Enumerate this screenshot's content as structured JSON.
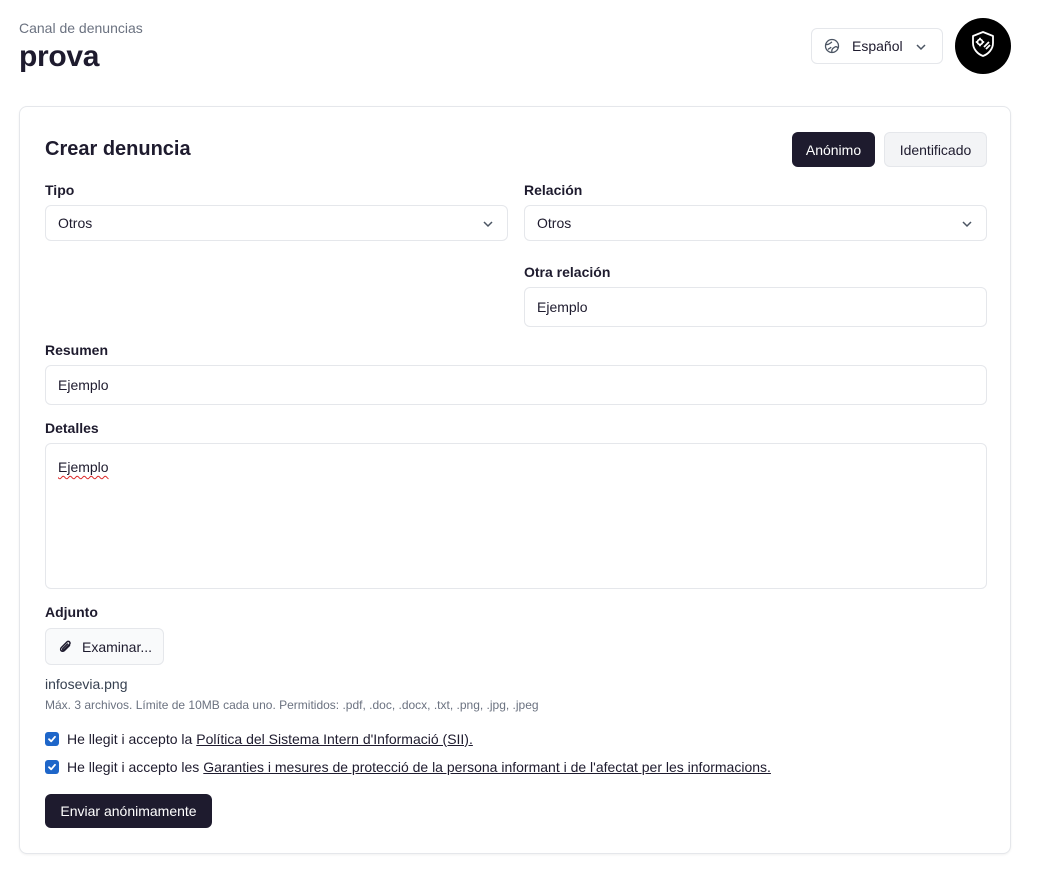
{
  "header": {
    "subtitle": "Canal de denuncias",
    "title": "prova"
  },
  "language": {
    "selected": "Español",
    "icon": "globe-icon"
  },
  "logo": {
    "icon": "shield-gear-icon"
  },
  "form": {
    "title": "Crear denuncia",
    "mode_anonymous": "Anónimo",
    "mode_identified": "Identificado",
    "tipo": {
      "label": "Tipo",
      "value": "Otros"
    },
    "relacion": {
      "label": "Relación",
      "value": "Otros"
    },
    "otra_relacion": {
      "label": "Otra relación",
      "value": "Ejemplo"
    },
    "resumen": {
      "label": "Resumen",
      "value": "Ejemplo"
    },
    "detalles": {
      "label": "Detalles",
      "value": "Ejemplo"
    },
    "adjunto": {
      "label": "Adjunto",
      "button_label": "Examinar...",
      "file_name": "infosevia.png",
      "help": "Máx. 3 archivos. Límite de 10MB cada uno. Permitidos: .pdf, .doc, .docx, .txt, .png, .jpg, .jpeg"
    },
    "consent1": {
      "text": "He llegit i accepto la",
      "link": "Política del Sistema Intern d'Informació (SII).",
      "checked": true
    },
    "consent2": {
      "text": "He llegit i accepto les",
      "link": "Garanties i mesures de protecció de la persona informant i de l'afectat per les informacions.",
      "checked": true
    },
    "submit_label": "Enviar anónimamente"
  },
  "colors": {
    "primary": "#1e1b2e",
    "checkbox": "#1e66c9",
    "border": "#e5e7eb"
  }
}
